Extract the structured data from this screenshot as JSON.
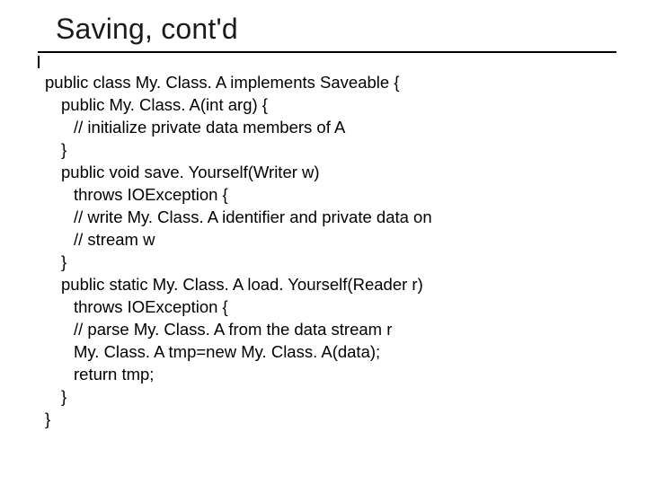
{
  "slide": {
    "title": "Saving, cont'd",
    "code": {
      "l0": "public class My. Class. A implements Saveable {",
      "l1": "public My. Class. A(int arg) {",
      "l2": "// initialize private data members of A",
      "l3": "}",
      "l4": "public void save. Yourself(Writer w)",
      "l5": "throws IOException {",
      "l6": "// write My. Class. A identifier and private data on",
      "l7": "// stream w",
      "l8": "}",
      "l9": "public static My. Class. A load. Yourself(Reader r)",
      "l10": "throws IOException {",
      "l11": "// parse My. Class. A from the data stream r",
      "l12": "My. Class. A tmp=new My. Class. A(data);",
      "l13": "return tmp;",
      "l14": "}",
      "l15": "}"
    }
  }
}
